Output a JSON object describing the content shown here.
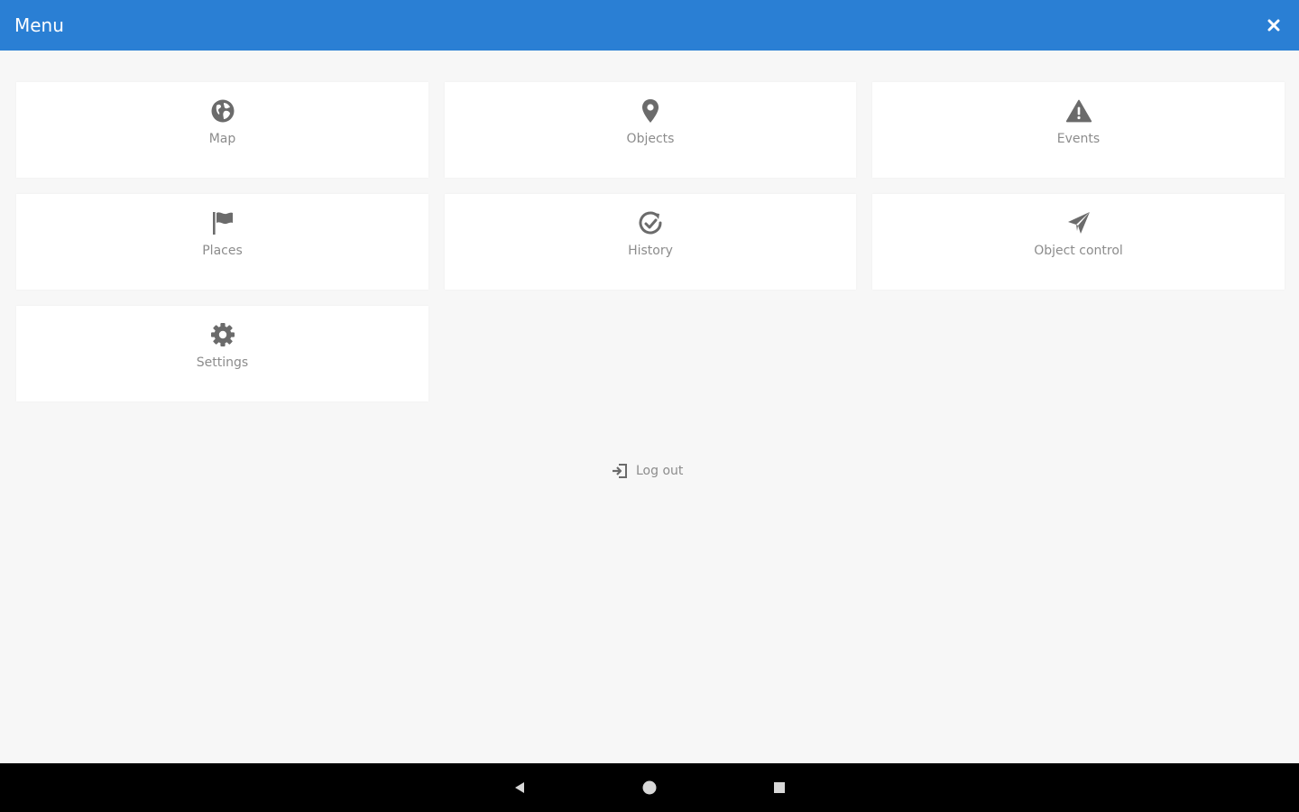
{
  "colors": {
    "accent": "#2a7fd4",
    "icon": "#6b6b6b",
    "label": "#8c8c8c"
  },
  "topbar": {
    "title": "Menu",
    "close_icon": "close-icon"
  },
  "menu": {
    "items": [
      {
        "label": "Map",
        "icon": "globe-icon"
      },
      {
        "label": "Objects",
        "icon": "map-pin-icon"
      },
      {
        "label": "Events",
        "icon": "warning-icon"
      },
      {
        "label": "Places",
        "icon": "flag-icon"
      },
      {
        "label": "History",
        "icon": "history-icon"
      },
      {
        "label": "Object control",
        "icon": "paper-plane-icon"
      },
      {
        "label": "Settings",
        "icon": "gear-icon"
      }
    ]
  },
  "logout": {
    "label": "Log out",
    "icon": "logout-icon"
  },
  "system_nav": {
    "back_icon": "back-icon",
    "home_icon": "home-icon",
    "recents_icon": "recents-icon"
  }
}
